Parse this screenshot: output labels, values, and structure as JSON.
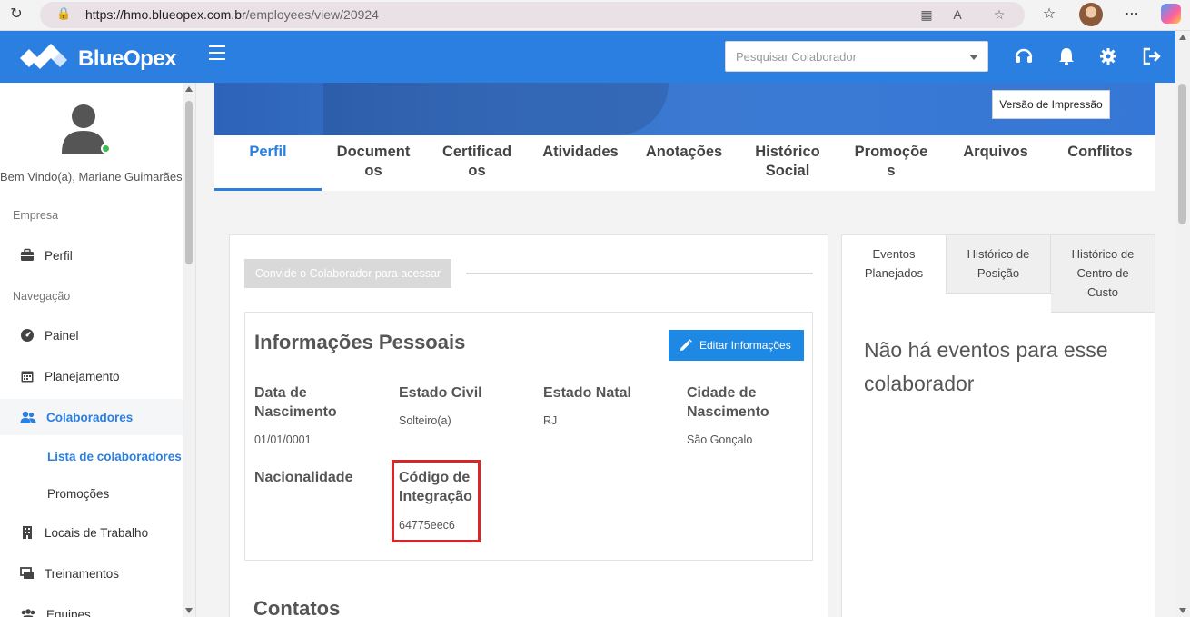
{
  "browser": {
    "url_host": "https://hmo.blueopex.com.br",
    "url_path": "/employees/view/20924"
  },
  "header": {
    "logo_text": "BlueOpex",
    "search_placeholder": "Pesquisar Colaborador"
  },
  "sidebar": {
    "welcome": "Bem Vindo(a), Mariane Guimarães",
    "section_empresa": "Empresa",
    "section_navegacao": "Navegação",
    "items": [
      {
        "label": "Perfil",
        "icon": "briefcase-icon"
      },
      {
        "label": "Painel",
        "icon": "dashboard-icon"
      },
      {
        "label": "Planejamento",
        "icon": "calendar-icon"
      },
      {
        "label": "Colaboradores",
        "icon": "users-icon"
      },
      {
        "label": "Locais de Trabalho",
        "icon": "building-icon"
      },
      {
        "label": "Treinamentos",
        "icon": "training-icon"
      },
      {
        "label": "Equipes",
        "icon": "team-icon"
      }
    ],
    "sub_items": [
      {
        "label": "Lista de colaboradores"
      },
      {
        "label": "Promoções"
      }
    ]
  },
  "main": {
    "print_button": "Versão de Impressão",
    "tabs": [
      {
        "l1": "Perfil",
        "l2": ""
      },
      {
        "l1": "Document",
        "l2": "os"
      },
      {
        "l1": "Certificad",
        "l2": "os"
      },
      {
        "l1": "Atividades",
        "l2": ""
      },
      {
        "l1": "Anotações",
        "l2": ""
      },
      {
        "l1": "Histórico",
        "l2": "Social"
      },
      {
        "l1": "Promoçõe",
        "l2": "s"
      },
      {
        "l1": "Arquivos",
        "l2": ""
      },
      {
        "l1": "Conflitos",
        "l2": ""
      }
    ],
    "invite_button": "Convide o Colaborador para acessar",
    "personal_title": "Informações Pessoais",
    "edit_button": "Editar Informações",
    "fields": {
      "birth_date_label_1": "Data de",
      "birth_date_label_2": "Nascimento",
      "birth_date_value": "01/01/0001",
      "civil_label": "Estado Civil",
      "civil_value": "Solteiro(a)",
      "state_label": "Estado Natal",
      "state_value": "RJ",
      "city_label_1": "Cidade de",
      "city_label_2": "Nascimento",
      "city_value": "São Gonçalo",
      "nationality_label": "Nacionalidade",
      "code_label_1": "Código de",
      "code_label_2": "Integração",
      "code_value": "64775eec6"
    },
    "contacts_title": "Contatos",
    "right_tabs": [
      {
        "l1": "Eventos",
        "l2": "Planejados",
        "l3": ""
      },
      {
        "l1": "Histórico de",
        "l2": "Posição",
        "l3": ""
      },
      {
        "l1": "Histórico de",
        "l2": "Centro de",
        "l3": "Custo"
      }
    ],
    "no_events_1": "Não há eventos para esse",
    "no_events_2": "colaborador"
  },
  "colors": {
    "brand": "#2b7fe0",
    "edit_button": "#1e88e5",
    "highlight": "#d9262b",
    "online": "#3cba54"
  }
}
